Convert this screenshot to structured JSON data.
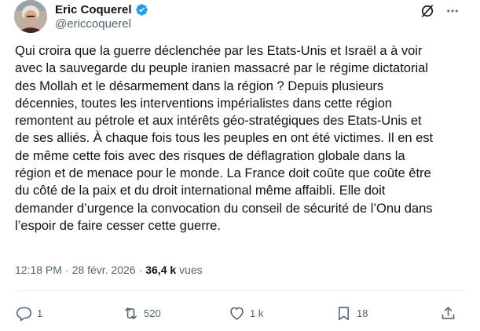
{
  "author": {
    "display_name": "Eric Coquerel",
    "handle": "@ericcoquerel",
    "verified_icon": "verified-badge-icon"
  },
  "tweet": {
    "text": "Qui croira que la guerre déclenchée par les Etats-Unis et Israël a à voir\navec la sauvegarde du peuple iranien massacré par le régime dictatorial\ndes Mollah et le désarmement dans la région ? Depuis plusieurs\ndécennies, toutes les interventions impérialistes dans cette région\nremontent au pétrole et aux intérêts géo-stratégiques des Etats-Unis et\nde ses alliés. À chaque fois tous les peuples en ont été victimes. Il en est\nde même cette fois avec des risques de déflagration globale dans la\nrégion et de menace pour le monde. La France doit coûte que coûte être\ndu côté de la paix et du droit international même affaibli. Elle doit\ndemander d’urgence la convocation du conseil de sécurité de l’Onu dans\nl’espoir de faire cesser cette guerre."
  },
  "meta": {
    "time": "12:18 PM",
    "separator": "·",
    "date": "28 févr. 2026",
    "separator2": "·",
    "views_count": "36,4 k",
    "views_label": "vues"
  },
  "actions": {
    "reply_count": "1",
    "repost_count": "520",
    "like_count": "1 k",
    "bookmark_count": "18"
  },
  "colors": {
    "text": "#0f1419",
    "secondary": "#536471",
    "verified": "#1d9bf0",
    "divider": "#eff3f4"
  }
}
